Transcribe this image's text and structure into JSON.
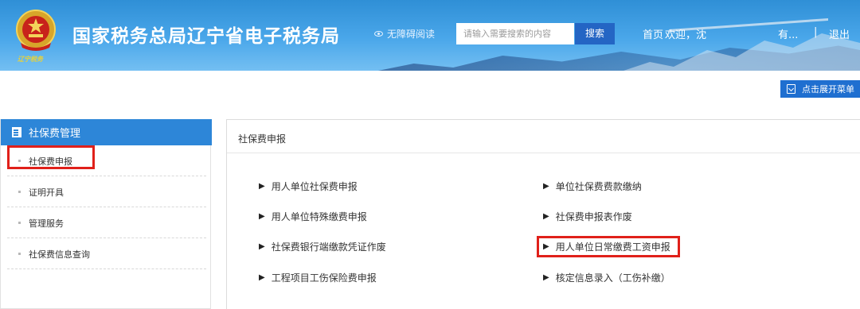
{
  "header": {
    "title": "国家税务总局辽宁省电子税务局",
    "emblem_subtitle": "辽宁税务",
    "accessibility_label": "无障碍阅读",
    "search": {
      "placeholder": "请输入需要搜索的内容",
      "button_label": "搜索"
    },
    "nav": {
      "home": "首页",
      "welcome": "欢迎，沈",
      "user": "有...",
      "separator": "|",
      "logout": "退出"
    }
  },
  "expand_menu": {
    "label": "点击展开菜单"
  },
  "sidebar": {
    "title": "社保费管理",
    "items": [
      {
        "label": "社保费申报"
      },
      {
        "label": "证明开具"
      },
      {
        "label": "管理服务"
      },
      {
        "label": "社保费信息查询"
      }
    ]
  },
  "main": {
    "title": "社保费申报",
    "links": [
      {
        "label": "用人单位社保费申报"
      },
      {
        "label": "单位社保费费款缴纳"
      },
      {
        "label": "用人单位特殊缴费申报"
      },
      {
        "label": "社保费申报表作废"
      },
      {
        "label": "社保费银行端缴款凭证作废"
      },
      {
        "label": "用人单位日常缴费工资申报"
      },
      {
        "label": "工程项目工伤保险费申报"
      },
      {
        "label": "核定信息录入（工伤补缴）"
      }
    ]
  },
  "colors": {
    "header_blue": "#3a9be0",
    "accent_blue": "#2d86d8",
    "highlight_red": "#e0201a"
  }
}
